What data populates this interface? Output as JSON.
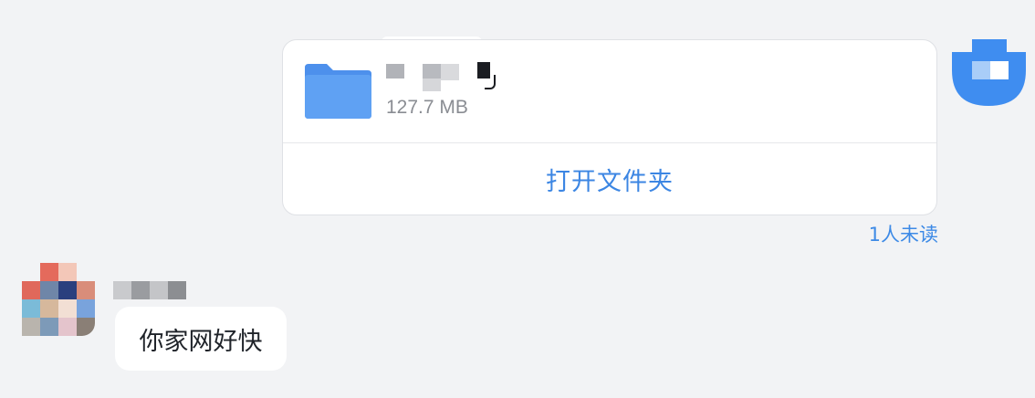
{
  "file_message": {
    "file_size": "127.7 MB",
    "open_folder_label": "打开文件夹",
    "unread_status": "1人未读",
    "folder_icon": "folder-icon",
    "accent_color": "#3c86e3",
    "folder_color": "#5a9cf0"
  },
  "incoming_message": {
    "text": "你家网好快"
  }
}
